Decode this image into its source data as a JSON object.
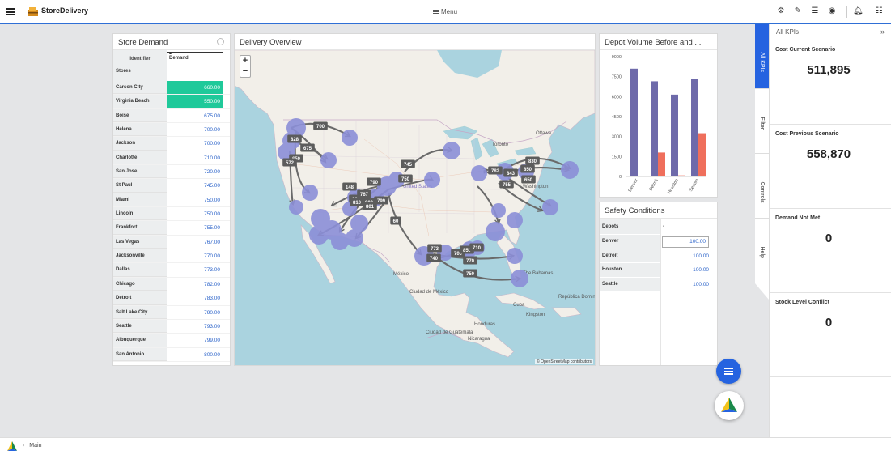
{
  "app": {
    "title": "StoreDelivery",
    "menu_label": "Menu"
  },
  "store_demand": {
    "title": "Store Demand",
    "header_identifier": "Identifier",
    "header_stores": "Stores",
    "header_demand": "Demand",
    "rows": [
      {
        "name": "Carson City",
        "value": "660.00",
        "highlight": true
      },
      {
        "name": "Virginia Beach",
        "value": "550.00",
        "highlight": true
      },
      {
        "name": "Boise",
        "value": "675.00"
      },
      {
        "name": "Helena",
        "value": "700.00"
      },
      {
        "name": "Jackson",
        "value": "700.00"
      },
      {
        "name": "Charlotte",
        "value": "710.00"
      },
      {
        "name": "San Jose",
        "value": "720.00"
      },
      {
        "name": "St Paul",
        "value": "745.00"
      },
      {
        "name": "Miami",
        "value": "750.00"
      },
      {
        "name": "Lincoln",
        "value": "750.00"
      },
      {
        "name": "Frankfort",
        "value": "755.00"
      },
      {
        "name": "Las Vegas",
        "value": "767.00"
      },
      {
        "name": "Jacksonville",
        "value": "770.00"
      },
      {
        "name": "Dallas",
        "value": "773.00"
      },
      {
        "name": "Chicago",
        "value": "782.00"
      },
      {
        "name": "Detroit",
        "value": "783.00"
      },
      {
        "name": "Salt Lake City",
        "value": "790.00"
      },
      {
        "name": "Seattle",
        "value": "793.00"
      },
      {
        "name": "Albuquerque",
        "value": "799.00"
      },
      {
        "name": "San Antonio",
        "value": "800.00"
      }
    ]
  },
  "delivery": {
    "title": "Delivery Overview",
    "zoom_in": "+",
    "zoom_out": "−",
    "attribution": "© OpenStreetMap contributors",
    "place_labels": [
      "Ottawa",
      "Toronto",
      "Washington",
      "United States",
      "México",
      "Ciudad de México",
      "Ciudad de Guatemala",
      "Honduras",
      "Nicaragua",
      "Kingston",
      "Cuba",
      "The Bahamas",
      "República Dominicana"
    ],
    "flow_labels": [
      "700",
      "828",
      "675",
      "650",
      "572",
      "745",
      "750",
      "830",
      "782",
      "843",
      "850",
      "755",
      "650",
      "148",
      "790",
      "820",
      "767",
      "810",
      "800",
      "801",
      "799",
      "60",
      "773",
      "740",
      "700",
      "850",
      "710",
      "770",
      "750"
    ]
  },
  "chart_data": {
    "type": "bar",
    "title": "Depot Volume Before and ...",
    "categories": [
      "Denver",
      "Detroit",
      "Houston",
      "Seattle"
    ],
    "series": [
      {
        "values": [
          8100,
          7150,
          6150,
          7300
        ],
        "color": "#6e6aaa"
      },
      {
        "values": [
          60,
          1800,
          80,
          3250
        ],
        "color": "#ef6f5c"
      }
    ],
    "ylim": [
      0,
      9000
    ],
    "yticks": [
      "9000",
      "7500",
      "6000",
      "4500",
      "3000",
      "1500",
      "0"
    ]
  },
  "safety": {
    "title": "Safety Conditions",
    "header_depots": "Depots",
    "header_dash": "-",
    "rows": [
      {
        "name": "Denver",
        "value": "100.00",
        "editing": true
      },
      {
        "name": "Detroit",
        "value": "100.00"
      },
      {
        "name": "Houston",
        "value": "100.00"
      },
      {
        "name": "Seattle",
        "value": "100.00"
      }
    ]
  },
  "kpi": {
    "header": "All KPIs",
    "cards": [
      {
        "label": "Cost Current Scenario",
        "value": "511,895"
      },
      {
        "label": "Cost Previous Scenario",
        "value": "558,870"
      },
      {
        "label": "Demand Not Met",
        "value": "0"
      },
      {
        "label": "Stock Level Conflict",
        "value": "0"
      }
    ]
  },
  "vtabs": [
    "All KPIs",
    "Filter",
    "Controls",
    "Help"
  ],
  "breadcrumb": {
    "sep": "›",
    "label": "Main"
  },
  "colors": {
    "accent": "#2f6fd6",
    "highlight": "#1fc99a",
    "bar_before": "#6e6aaa",
    "bar_after": "#ef6f5c"
  }
}
